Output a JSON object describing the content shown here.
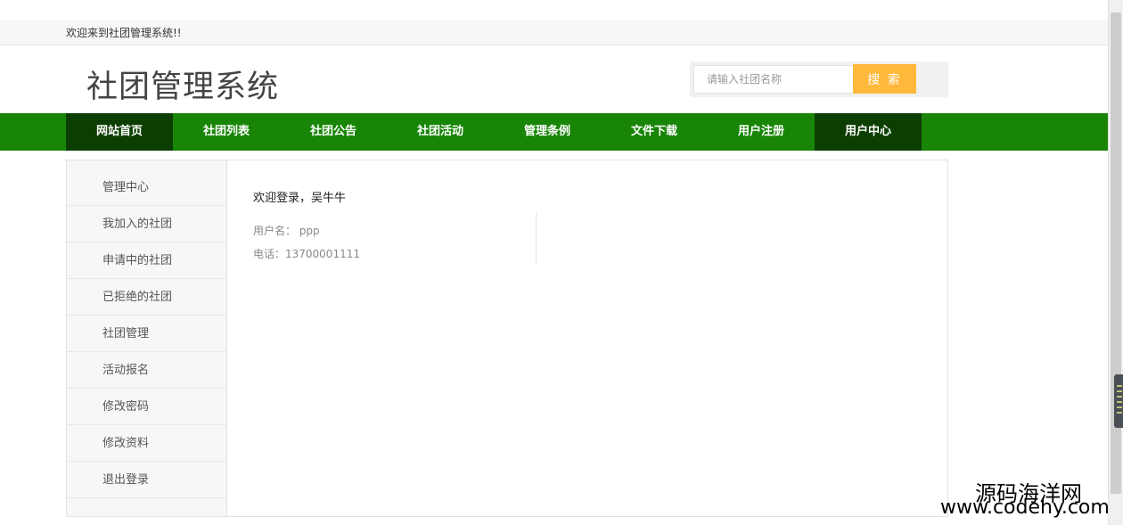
{
  "topbar": {
    "welcome_text": "欢迎来到社团管理系统!!"
  },
  "header": {
    "site_title": "社团管理系统",
    "search_placeholder": "请输入社团名称",
    "search_button_label": "搜 索"
  },
  "nav": {
    "items": [
      "网站首页",
      "社团列表",
      "社团公告",
      "社团活动",
      "管理条例",
      "文件下载",
      "用户注册",
      "用户中心"
    ]
  },
  "sidebar": {
    "items": [
      "管理中心",
      "我加入的社团",
      "申请中的社团",
      "已拒绝的社团",
      "社团管理",
      "活动报名",
      "修改密码",
      "修改资料",
      "退出登录"
    ]
  },
  "main": {
    "greeting": "欢迎登录，吴牛牛",
    "username_line": "用户名： ppp",
    "phone_line": "电话：13700001111"
  },
  "watermark": {
    "cn": "源码海洋网",
    "url": "www.codehy.com"
  },
  "colors": {
    "nav_bg": "#188507",
    "nav_active": "#0c3e02",
    "search_button": "#ffb83a"
  }
}
